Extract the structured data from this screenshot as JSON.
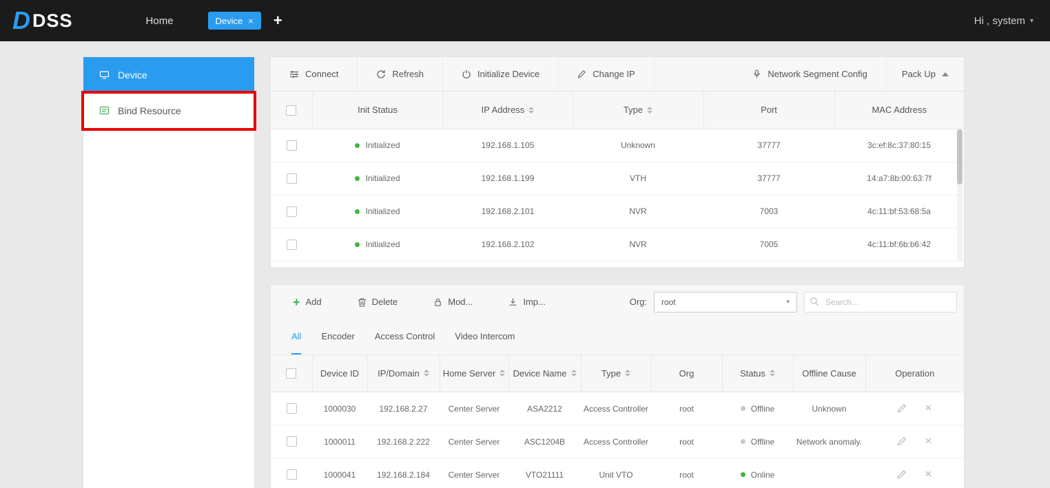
{
  "colors": {
    "accent": "#2a9cf0",
    "online": "#3fb73f",
    "offline": "#c9c9c9",
    "annotation_red": "#e60000",
    "topbar_bg": "#1b1b1b",
    "add_green": "#39b54a"
  },
  "topbar": {
    "logo": "DSS",
    "home_tab": "Home",
    "device_tab": "Device",
    "user": "Hi , system"
  },
  "sidebar": {
    "items": [
      {
        "label": "Device",
        "active": true
      },
      {
        "label": "Bind Resource",
        "annotated": true
      }
    ]
  },
  "discover": {
    "toolbar": {
      "connect": "Connect",
      "refresh": "Refresh",
      "initialize": "Initialize Device",
      "change_ip": "Change IP",
      "network_segment": "Network Segment Config",
      "pack_up": "Pack Up"
    },
    "table": {
      "headers": [
        "Init Status",
        "IP Address",
        "Type",
        "Port",
        "MAC Address"
      ],
      "rows": [
        {
          "init_status": "Initialized",
          "online": true,
          "ip": "192.168.1.105",
          "type": "Unknown",
          "port": "37777",
          "mac": "3c:ef:8c:37:80:15"
        },
        {
          "init_status": "Initialized",
          "online": true,
          "ip": "192.168.1.199",
          "type": "VTH",
          "port": "37777",
          "mac": "14:a7:8b:00:63:7f"
        },
        {
          "init_status": "Initialized",
          "online": true,
          "ip": "192.168.2.101",
          "type": "NVR",
          "port": "7003",
          "mac": "4c:11:bf:53:68:5a"
        },
        {
          "init_status": "Initialized",
          "online": true,
          "ip": "192.168.2.102",
          "type": "NVR",
          "port": "7005",
          "mac": "4c:11:bf:6b:b6:42"
        }
      ]
    }
  },
  "devices": {
    "toolbar": {
      "add": "Add",
      "delete": "Delete",
      "modify": "Mod...",
      "import": "Imp...",
      "org_label": "Org:",
      "org_value": "root",
      "search_placeholder": "Search..."
    },
    "tabs": [
      {
        "label": "All",
        "active": true
      },
      {
        "label": "Encoder"
      },
      {
        "label": "Access Control"
      },
      {
        "label": "Video Intercom"
      }
    ],
    "table": {
      "headers": [
        "Device ID",
        "IP/Domain",
        "Home Server",
        "Device Name",
        "Type",
        "Org",
        "Status",
        "Offline Cause",
        "Operation"
      ],
      "rows": [
        {
          "device_id": "1000030",
          "ip": "192.168.2.27",
          "home_server": "Center Server",
          "device_name": "ASA2212",
          "type": "Access Controller",
          "org": "root",
          "status": "Offline",
          "online": false,
          "offline_cause": "Unknown"
        },
        {
          "device_id": "1000011",
          "ip": "192.168.2.222",
          "home_server": "Center Server",
          "device_name": "ASC1204B",
          "type": "Access Controller",
          "org": "root",
          "status": "Offline",
          "online": false,
          "offline_cause": "Network anomaly."
        },
        {
          "device_id": "1000041",
          "ip": "192.168.2.184",
          "home_server": "Center Server",
          "device_name": "VTO21111",
          "type": "Unit VTO",
          "org": "root",
          "status": "Online",
          "online": true,
          "offline_cause": ""
        }
      ]
    }
  }
}
